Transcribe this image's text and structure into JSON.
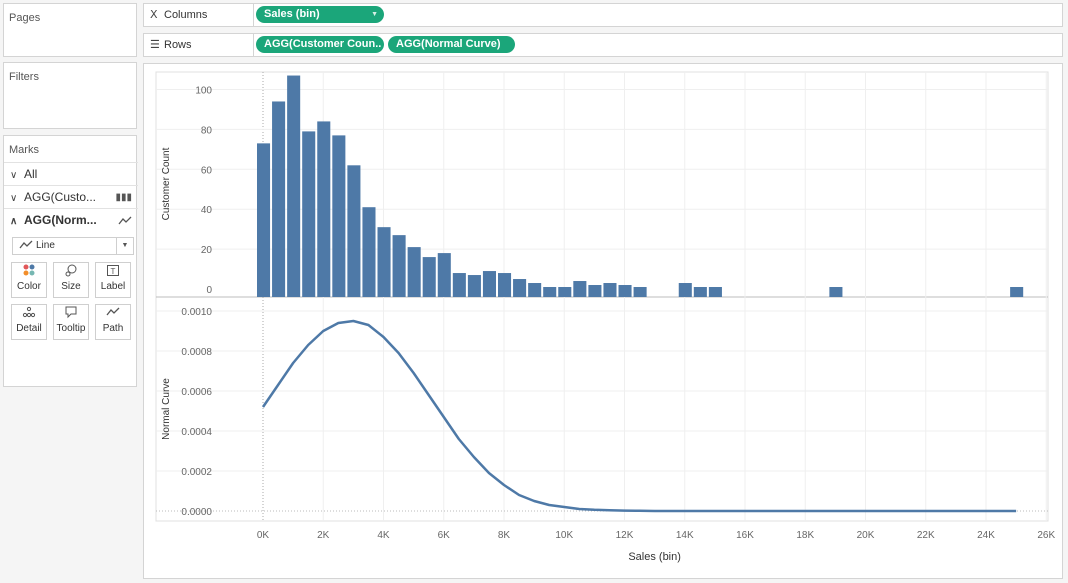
{
  "pages": {
    "title": "Pages"
  },
  "filters": {
    "title": "Filters"
  },
  "marks": {
    "title": "Marks",
    "all_label": "All",
    "cards": [
      {
        "label": "AGG(Custo...",
        "icon": "bar-chart-icon"
      },
      {
        "label": "AGG(Norm...",
        "icon": "line-chart-icon"
      }
    ],
    "mark_type": "Line",
    "buttons": [
      {
        "label": "Color",
        "icon": "color-icon"
      },
      {
        "label": "Size",
        "icon": "size-icon"
      },
      {
        "label": "Label",
        "icon": "label-icon"
      },
      {
        "label": "Detail",
        "icon": "detail-icon"
      },
      {
        "label": "Tooltip",
        "icon": "tooltip-icon"
      },
      {
        "label": "Path",
        "icon": "path-icon"
      }
    ]
  },
  "shelves": {
    "columns_label": "Columns",
    "rows_label": "Rows",
    "columns_pills": [
      "Sales (bin)"
    ],
    "rows_pills": [
      "AGG(Customer Coun..",
      "AGG(Normal Curve)"
    ]
  },
  "colors": {
    "mark": "#4e79a7",
    "pill": "#1ba67a"
  },
  "chart_data": [
    {
      "type": "bar",
      "ylabel": "Customer Count",
      "ylim": [
        0,
        110
      ],
      "yticks": [
        0,
        20,
        40,
        60,
        80,
        100
      ],
      "x": [
        0,
        500,
        1000,
        1500,
        2000,
        2500,
        3000,
        3500,
        4000,
        4500,
        5000,
        5500,
        6000,
        6500,
        7000,
        7500,
        8000,
        8500,
        9000,
        9500,
        10000,
        10500,
        11000,
        11500,
        12000,
        12500,
        14000,
        14500,
        15000,
        19000,
        25000
      ],
      "values": [
        73,
        94,
        107,
        79,
        84,
        77,
        62,
        41,
        31,
        27,
        21,
        16,
        18,
        8,
        7,
        9,
        8,
        5,
        3,
        1,
        1,
        4,
        2,
        3,
        2,
        1,
        3,
        1,
        1,
        1,
        1
      ]
    },
    {
      "type": "line",
      "ylabel": "Normal Curve",
      "ylim": [
        0,
        0.00102
      ],
      "yticks": [
        "0.0000",
        "0.0002",
        "0.0004",
        "0.0006",
        "0.0008",
        "0.0010"
      ],
      "x": [
        0,
        500,
        1000,
        1500,
        2000,
        2500,
        3000,
        3500,
        4000,
        4500,
        5000,
        5500,
        6000,
        6500,
        7000,
        7500,
        8000,
        8500,
        9000,
        9500,
        10000,
        10500,
        11000,
        11500,
        12000,
        12500,
        13000,
        14000,
        16000,
        18000,
        20000,
        22000,
        25000
      ],
      "values": [
        0.00052,
        0.00063,
        0.00074,
        0.00083,
        0.0009,
        0.00094,
        0.00095,
        0.00093,
        0.00087,
        0.00079,
        0.00069,
        0.00058,
        0.00047,
        0.00036,
        0.00027,
        0.00019,
        0.00013,
        8e-05,
        5e-05,
        3e-05,
        2e-05,
        1e-05,
        6e-06,
        4e-06,
        2e-06,
        1e-06,
        0,
        0,
        0,
        0,
        0,
        0,
        0
      ]
    }
  ],
  "x_axis": {
    "label": "Sales (bin)",
    "ticks": [
      "0K",
      "2K",
      "4K",
      "6K",
      "8K",
      "10K",
      "12K",
      "14K",
      "16K",
      "18K",
      "20K",
      "22K",
      "24K",
      "26K"
    ]
  }
}
